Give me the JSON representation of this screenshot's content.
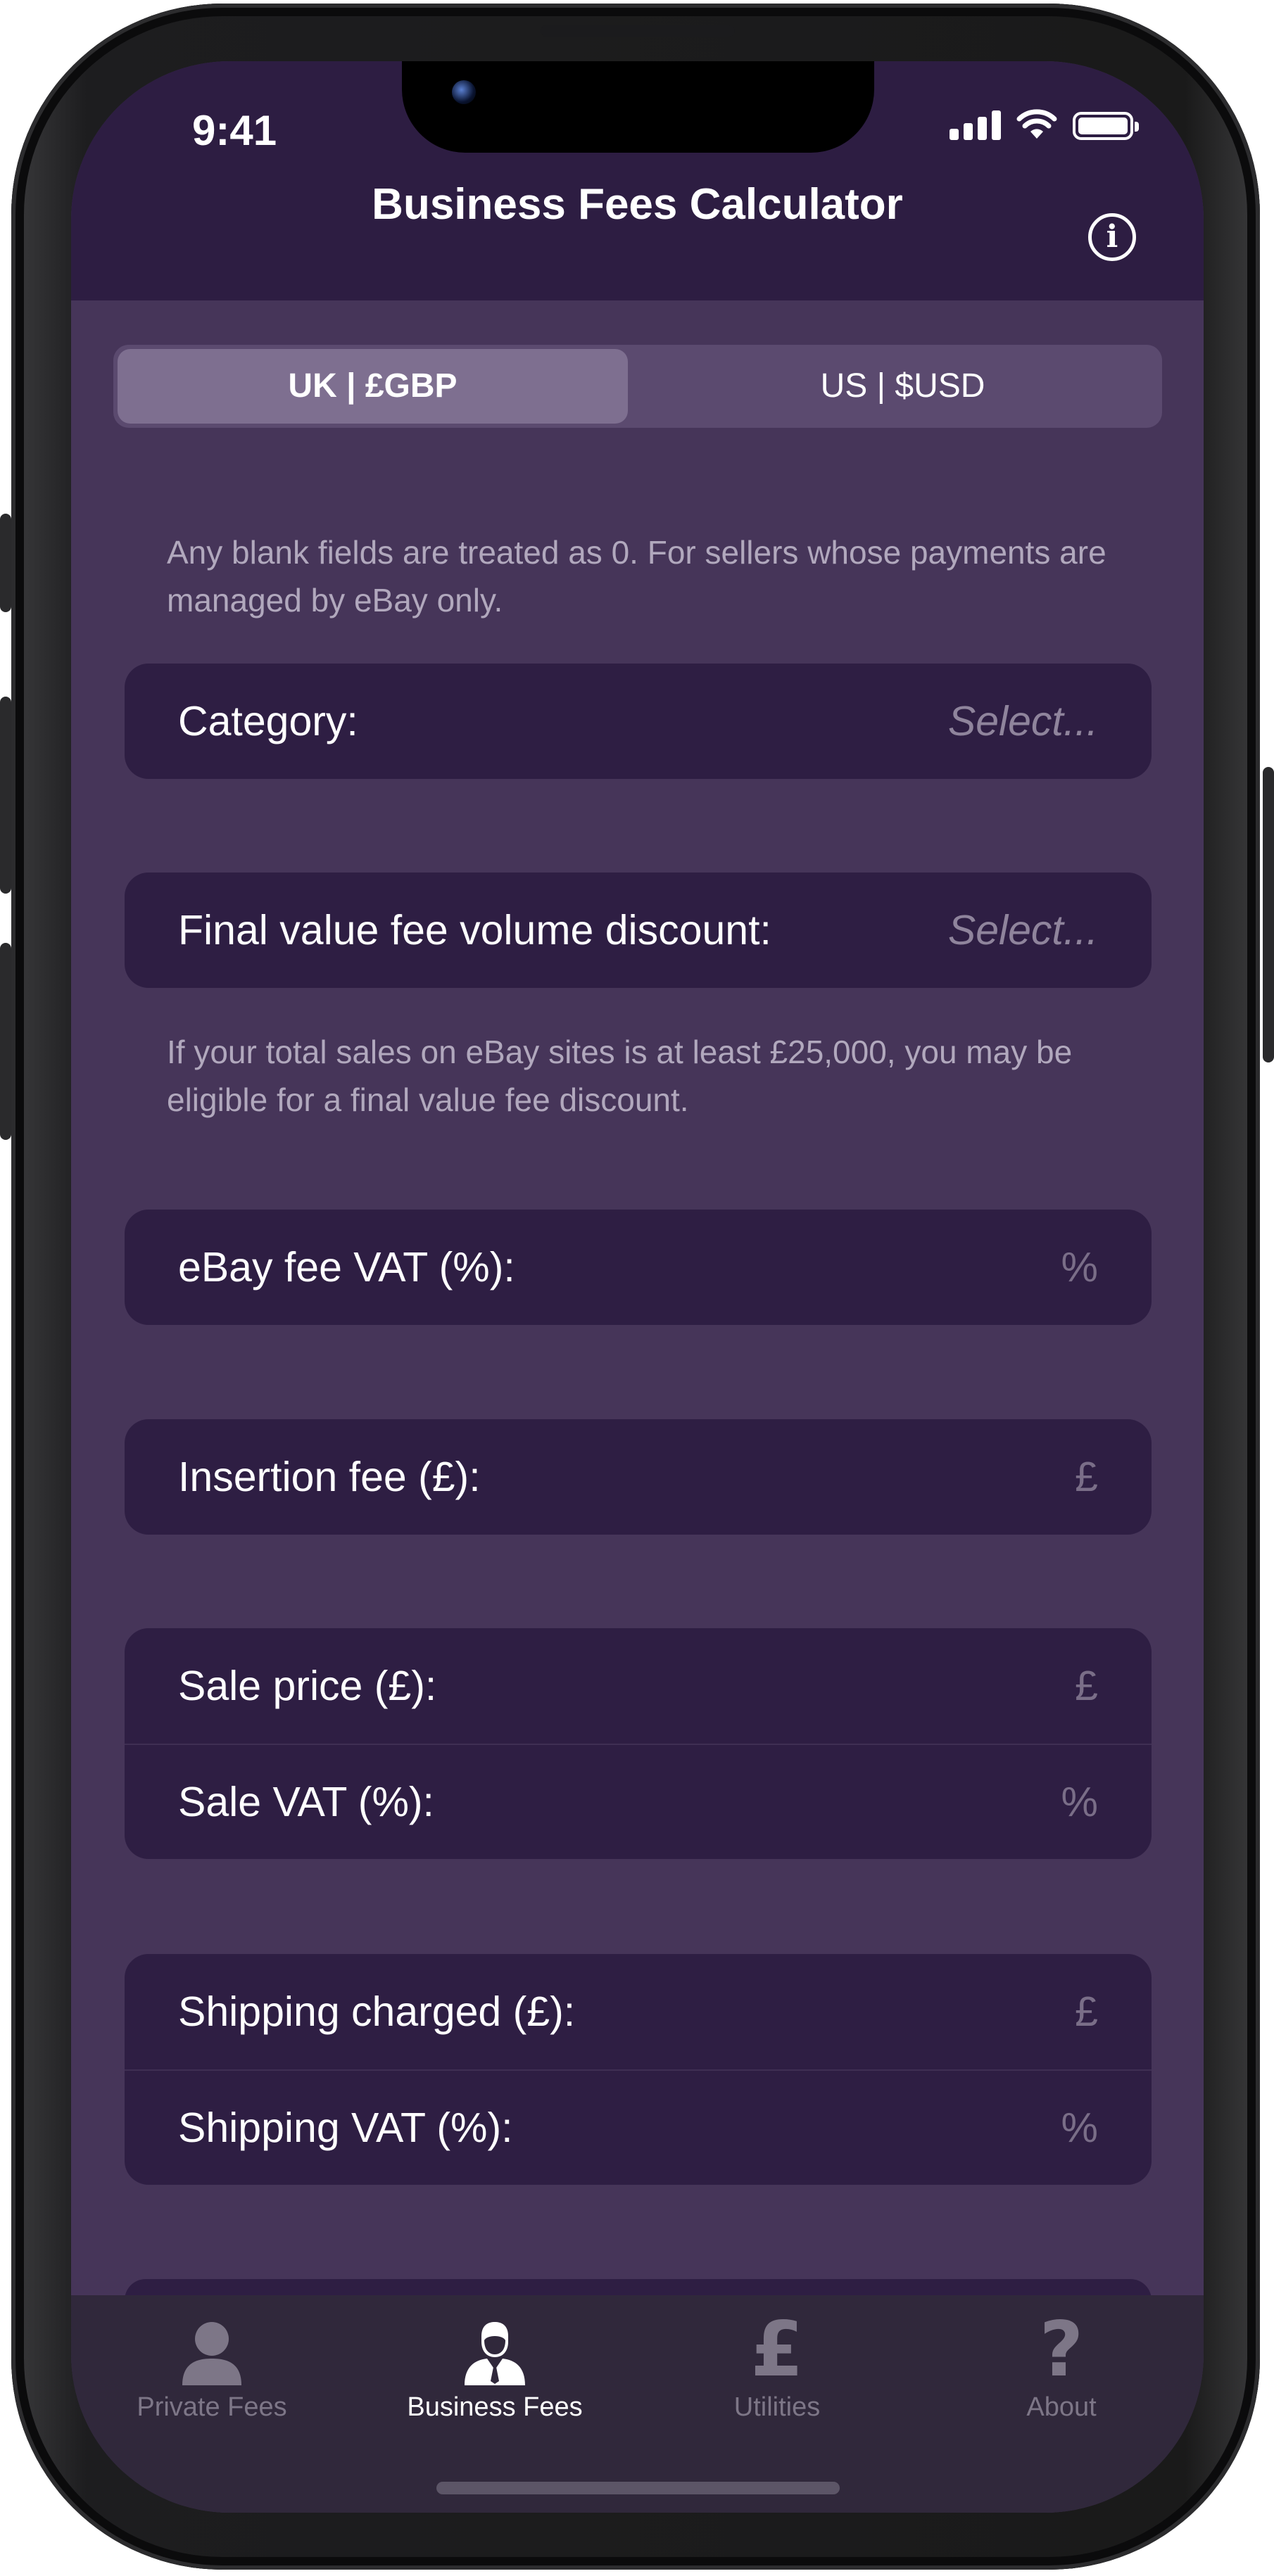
{
  "status": {
    "time": "9:41"
  },
  "header": {
    "title": "Business Fees Calculator",
    "info_icon": "info-circle-icon"
  },
  "currency_tabs": [
    {
      "label": "UK | £GBP",
      "selected": true
    },
    {
      "label": "US | $USD",
      "selected": false
    }
  ],
  "notes": {
    "blank_fields": "Any blank fields are treated as 0. For sellers whose payments are managed by eBay only.",
    "discount": "If your total sales on eBay sites is at least £25,000, you may be eligible for a final value fee discount."
  },
  "fields": {
    "category": {
      "label": "Category:",
      "value": "Select..."
    },
    "fvf_discount": {
      "label": "Final value fee volume discount:",
      "value": "Select..."
    },
    "ebay_vat": {
      "label": "eBay fee VAT (%):",
      "placeholder": "%"
    },
    "insertion_fee": {
      "label": "Insertion fee (£):",
      "placeholder": "£"
    },
    "sale_price": {
      "label": "Sale price (£):",
      "placeholder": "£"
    },
    "sale_vat": {
      "label": "Sale VAT (%):",
      "placeholder": "%"
    },
    "shipping_charged": {
      "label": "Shipping charged (£):",
      "placeholder": "£"
    },
    "shipping_vat": {
      "label": "Shipping VAT (%):",
      "placeholder": "%"
    }
  },
  "tabbar": [
    {
      "label": "Private Fees",
      "icon": "person-icon",
      "active": false
    },
    {
      "label": "Business Fees",
      "icon": "businessman-icon",
      "active": true
    },
    {
      "label": "Utilities",
      "icon": "pound-sign-icon",
      "active": false
    },
    {
      "label": "About",
      "icon": "question-mark-icon",
      "active": false
    }
  ],
  "colors": {
    "background": "#463559",
    "card": "#2e1e43",
    "navbar": "#2d1d42",
    "tabbar": "#30283b",
    "note_text": "#b1a8bd"
  }
}
